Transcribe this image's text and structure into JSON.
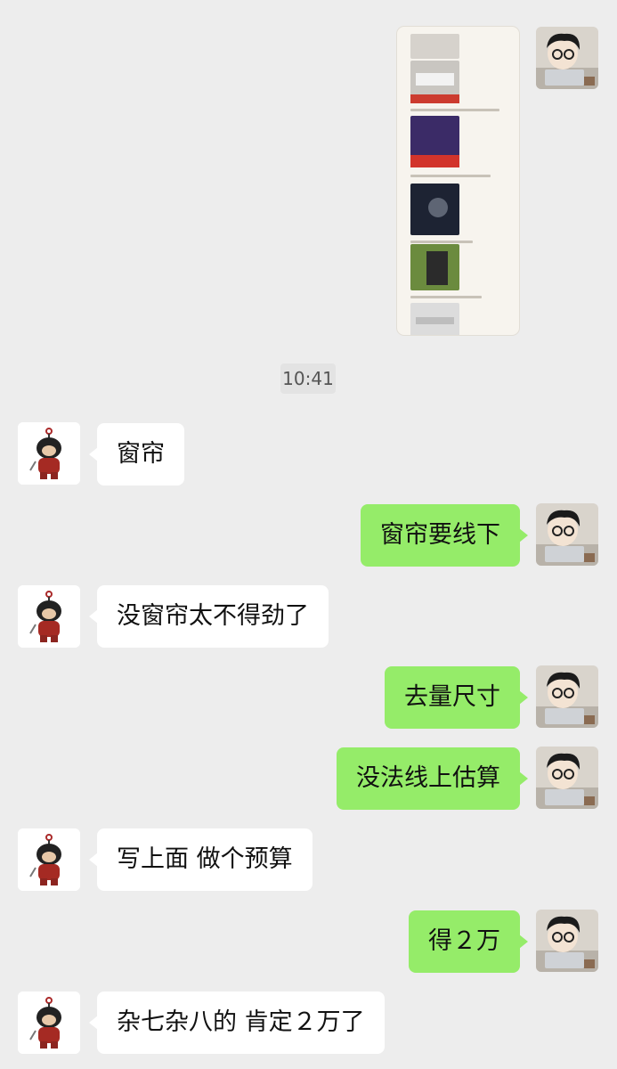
{
  "timestamp": "10:41",
  "messages": [
    {
      "from": "me",
      "type": "image",
      "alt": "shopping list screenshot"
    },
    {
      "from": "them",
      "text": "窗帘"
    },
    {
      "from": "me",
      "text": "窗帘要线下"
    },
    {
      "from": "them",
      "text": "没窗帘太不得劲了"
    },
    {
      "from": "me",
      "text": "去量尺寸"
    },
    {
      "from": "me",
      "text": "没法线上估算"
    },
    {
      "from": "them",
      "text": "写上面 做个预算"
    },
    {
      "from": "me",
      "text": "得２万"
    },
    {
      "from": "them",
      "text": "杂七杂八的 肯定２万了"
    }
  ],
  "colors": {
    "background": "#ededed",
    "outgoing_bubble": "#95ec69",
    "incoming_bubble": "#ffffff"
  },
  "icons": {
    "me_avatar": "cartoon-boy-with-laptop-avatar",
    "them_avatar": "red-doll-figure-avatar"
  }
}
